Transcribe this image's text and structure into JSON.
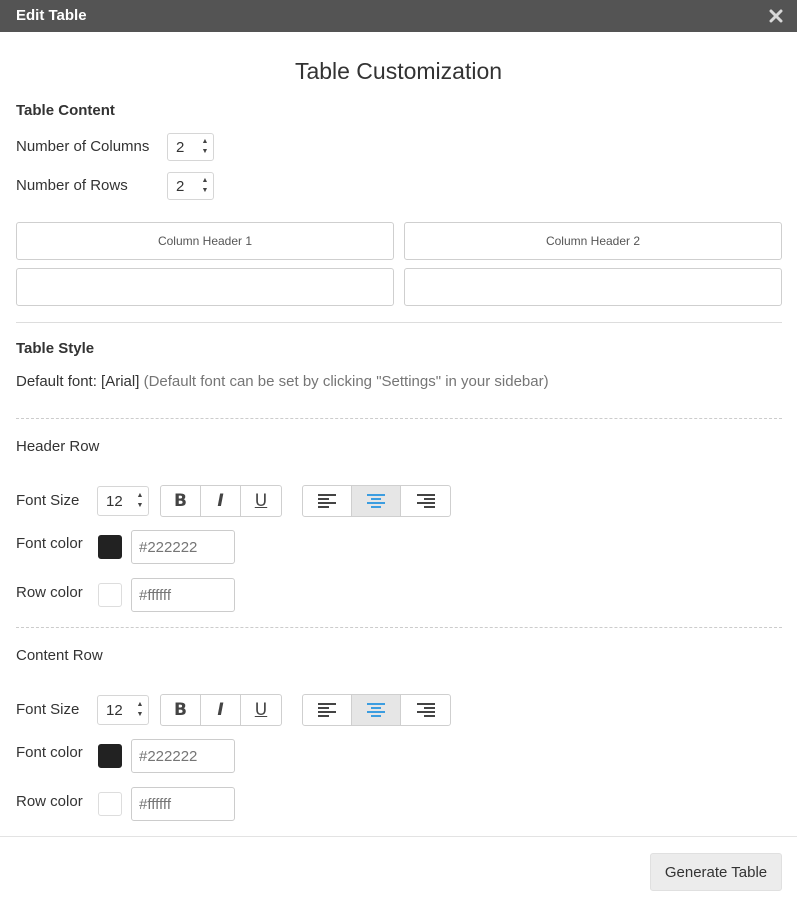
{
  "dialog": {
    "title": "Edit Table"
  },
  "heading": "Table Customization",
  "table_content": {
    "title": "Table Content",
    "columns_label": "Number of Columns",
    "columns_value": "2",
    "rows_label": "Number of Rows",
    "rows_value": "2",
    "header_cells": [
      "Column Header 1",
      "Column Header 2"
    ],
    "body_cells": [
      "",
      ""
    ]
  },
  "table_style": {
    "title": "Table Style",
    "default_font_prefix": "Default font: [Arial]",
    "default_font_hint": "(Default font can be set by clicking \"Settings\" in your sidebar)"
  },
  "header_row": {
    "title": "Header Row",
    "font_size_label": "Font Size",
    "font_size": "12",
    "font_color_label": "Font color",
    "font_color": "#222222",
    "row_color_label": "Row color",
    "row_color": "#ffffff",
    "bold": false,
    "italic": false,
    "underline": false,
    "alignment": "center"
  },
  "content_row": {
    "title": "Content Row",
    "font_size_label": "Font Size",
    "font_size": "12",
    "font_color_label": "Font color",
    "font_color": "#222222",
    "row_color_label": "Row color",
    "row_color": "#ffffff",
    "bold": false,
    "italic": false,
    "underline": false,
    "alignment": "center"
  },
  "format_buttons": {
    "bold": "B",
    "italic": "I",
    "underline": "U"
  },
  "colors": {
    "titlebar": "#545454",
    "active_align_icon": "#3c9de0",
    "icon": "#444444"
  },
  "icons": {
    "close": "close-icon",
    "spin_up": "arrow-up-icon",
    "spin_down": "arrow-down-icon"
  },
  "footer": {
    "generate_label": "Generate Table"
  }
}
